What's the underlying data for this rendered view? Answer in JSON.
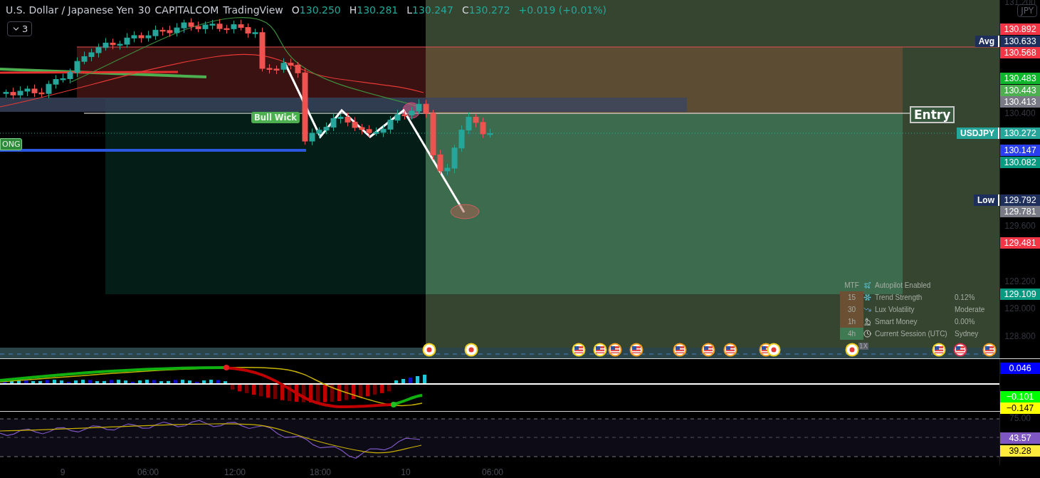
{
  "header": {
    "symbol": "U.S. Dollar / Japanese Yen",
    "interval": "30",
    "exchange": "CAPITALCOM",
    "source": "TradingView",
    "ohlc": [
      {
        "label": "O",
        "value": "130.250"
      },
      {
        "label": "H",
        "value": "130.281"
      },
      {
        "label": "L",
        "value": "130.247"
      },
      {
        "label": "C",
        "value": "130.272"
      }
    ],
    "change": "+0.019 (+0.01%)"
  },
  "indicator_toggle": {
    "count": "3"
  },
  "currency": "JPY",
  "bull_wick_label": "Bull Wick",
  "position_label": "ONG",
  "entry_label": "Entry",
  "marker_text": "1X",
  "price_tags": [
    {
      "text": "Avg",
      "color": "#1e2f5c"
    },
    {
      "text": "USDJPY",
      "color": "#26a69a"
    },
    {
      "text": "Low",
      "color": "#1e2f5c"
    }
  ],
  "price_axis": {
    "ticks": [
      "131.200",
      "130.400",
      "129.600",
      "129.200",
      "129.000",
      "128.800"
    ],
    "labels": [
      {
        "value": "130.892",
        "color": "#f23645"
      },
      {
        "value": "130.633",
        "color": "#1e2f5c"
      },
      {
        "value": "130.568",
        "color": "#f23645"
      },
      {
        "value": "130.483",
        "color": "#0fb52a"
      },
      {
        "value": "130.443",
        "color": "#4caf50"
      },
      {
        "value": "130.413",
        "color": "#787b86"
      },
      {
        "value": "130.272",
        "color": "#26a69a"
      },
      {
        "value": "130.147",
        "color": "#2a3ff0"
      },
      {
        "value": "130.082",
        "color": "#089981"
      },
      {
        "value": "129.792",
        "color": "#1e2f5c"
      },
      {
        "value": "129.781",
        "color": "#787b86"
      },
      {
        "value": "129.481",
        "color": "#f23645"
      },
      {
        "value": "129.109",
        "color": "#089981"
      }
    ]
  },
  "mtf_table": {
    "header": "MTF",
    "title": "Autopilot Enabled",
    "rows": [
      {
        "timeframe": "15",
        "color": "#6b5034",
        "kind": "trend",
        "label": "Trend Strength",
        "value": "0.12%"
      },
      {
        "timeframe": "30",
        "color": "#6b5034",
        "kind": "volatility",
        "label": "Lux Volatility",
        "value": "Moderate"
      },
      {
        "timeframe": "1h",
        "color": "#6b5034",
        "kind": "money",
        "label": "Smart Money",
        "value": "0.00%"
      },
      {
        "timeframe": "4h",
        "color": "#3f7a52",
        "kind": "session",
        "label": "Current Session (UTC)",
        "value": "Sydney"
      }
    ]
  },
  "events": [
    {
      "kind": "dot",
      "color": "#f0d020"
    },
    {
      "kind": "dot",
      "color": "#f0d020"
    },
    {
      "kind": "flag",
      "color": "#f0d020"
    },
    {
      "kind": "flag",
      "color": "#f0d020"
    },
    {
      "kind": "flag",
      "color": "#f59c1a"
    },
    {
      "kind": "flag",
      "color": "#f59c1a"
    },
    {
      "kind": "flag",
      "color": "#f59c1a"
    },
    {
      "kind": "flag",
      "color": "#f59c1a"
    },
    {
      "kind": "flag",
      "color": "#f59c1a"
    },
    {
      "kind": "flag",
      "color": "#f59c1a"
    },
    {
      "kind": "dot",
      "color": "#f0d020"
    },
    {
      "kind": "dot",
      "color": "#f0d020"
    },
    {
      "kind": "flag",
      "color": "#f0d020"
    },
    {
      "kind": "flag",
      "color": "#d6304a"
    },
    {
      "kind": "flag",
      "color": "#f59c1a"
    }
  ],
  "macd_pane": {
    "labels": [
      {
        "value": "0.046",
        "color": "#0000ff"
      },
      {
        "value": "−0.101",
        "color": "#00ff00"
      },
      {
        "value": "−0.147",
        "color": "#ffff00"
      }
    ]
  },
  "rsi_pane": {
    "ticks": [
      "75.00"
    ],
    "labels": [
      {
        "value": "43.57",
        "color": "#7e57c2"
      },
      {
        "value": "39.28",
        "color": "#ffeb3b"
      }
    ]
  },
  "time_axis": [
    "9",
    "06:00",
    "12:00",
    "18:00",
    "10",
    "06:00"
  ]
}
